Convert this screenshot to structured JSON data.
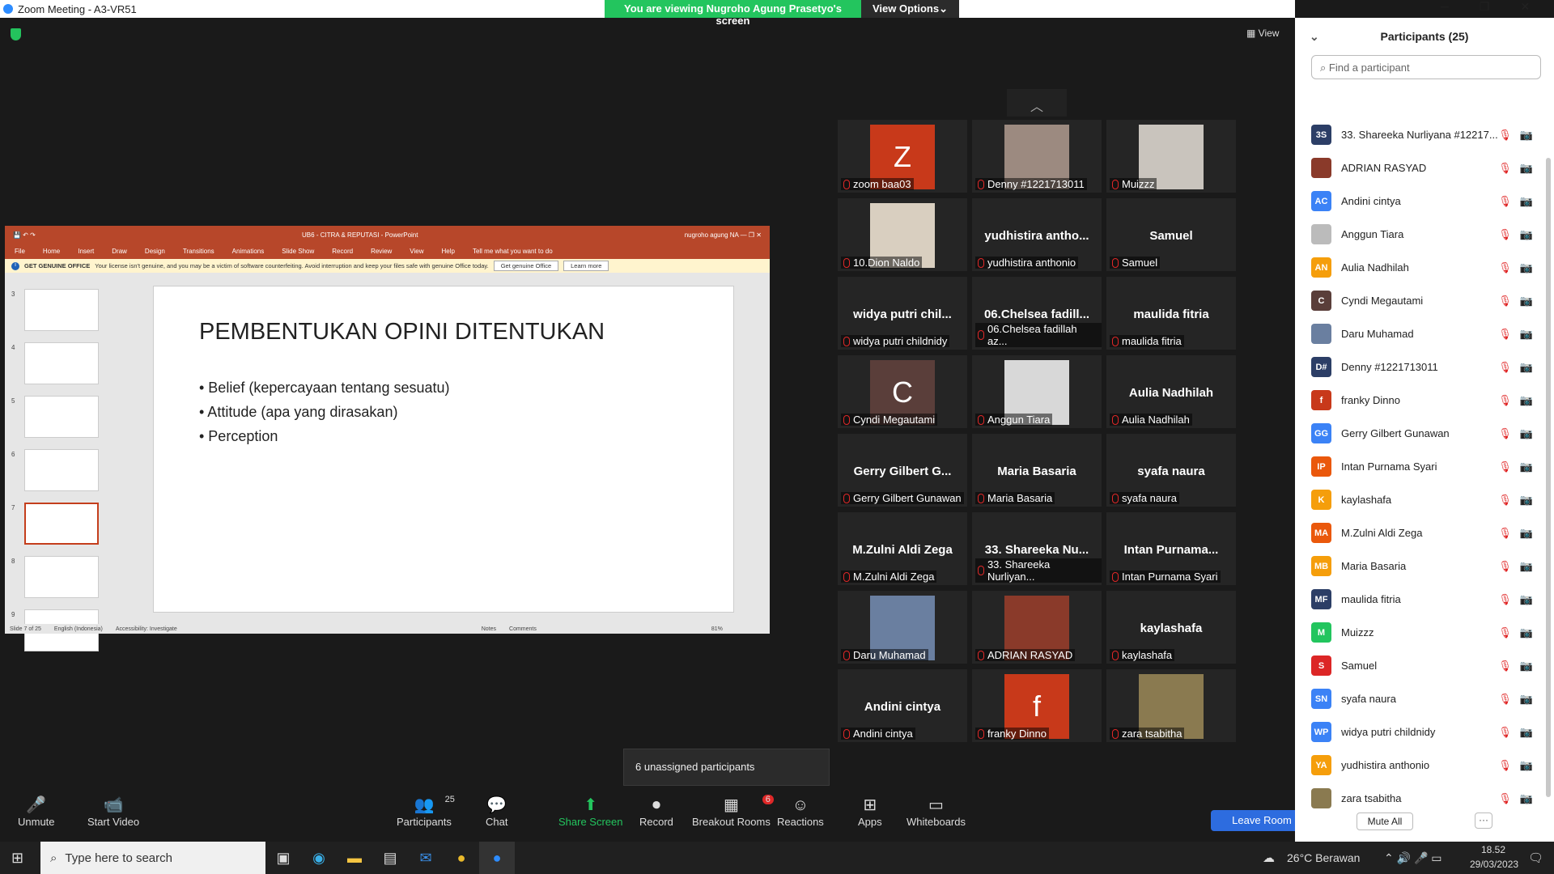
{
  "window": {
    "title": "Zoom Meeting - A3-VR51"
  },
  "banner": {
    "text": "You are viewing Nugroho Agung Prasetyo's screen",
    "view_options": "View Options"
  },
  "view_button": "View",
  "ppt": {
    "title": "UB6 - CITRA & REPUTASI  -  PowerPoint",
    "user": "nugroho agung",
    "user_initials": "NA",
    "tabs": [
      "File",
      "Home",
      "Insert",
      "Draw",
      "Design",
      "Transitions",
      "Animations",
      "Slide Show",
      "Record",
      "Review",
      "View",
      "Help",
      "Tell me what you want to do"
    ],
    "warning_title": "GET GENUINE OFFICE",
    "warning_text": "Your license isn't genuine, and you may be a victim of software counterfeiting. Avoid interruption and keep your files safe with genuine Office today.",
    "warning_btn": "Get genuine Office",
    "warning_more": "Learn more",
    "thumbs": [
      "3",
      "4",
      "5",
      "6",
      "7",
      "8",
      "9"
    ],
    "slide_title": "PEMBENTUKAN OPINI DITENTUKAN",
    "bullets": [
      "• Belief (kepercayaan tentang sesuatu)",
      "• Attitude (apa yang dirasakan)",
      "• Perception"
    ],
    "status": {
      "slide": "Slide 7 of 25",
      "lang": "English (Indonesia)",
      "access": "Accessibility: Investigate",
      "notes": "Notes",
      "comments": "Comments",
      "zoom": "81%"
    }
  },
  "gallery": [
    {
      "label": "zoom baa03",
      "avatar": "Z",
      "color": "#c8391a"
    },
    {
      "label": "Denny #1221713011",
      "avatar": "",
      "color": "#9c8a80"
    },
    {
      "label": "Muizzz",
      "avatar": "",
      "color": "#c9c4bd"
    },
    {
      "label": "10.Dion Naldo",
      "avatar": "",
      "color": "#d9cfc0"
    },
    {
      "label": "yudhistira anthonio",
      "name": "yudhistira antho..."
    },
    {
      "label": "Samuel",
      "name": "Samuel"
    },
    {
      "label": "widya putri childnidy",
      "name": "widya putri chil..."
    },
    {
      "label": "06.Chelsea fadillah az...",
      "name": "06.Chelsea fadill..."
    },
    {
      "label": "maulida fitria",
      "name": "maulida fitria"
    },
    {
      "label": "Cyndi Megautami",
      "avatar": "C",
      "color": "#5a3e3a"
    },
    {
      "label": "Anggun Tiara",
      "avatar": "",
      "color": "#d8d8d8"
    },
    {
      "label": "Aulia Nadhilah",
      "name": "Aulia Nadhilah"
    },
    {
      "label": "Gerry Gilbert Gunawan",
      "name": "Gerry Gilbert G..."
    },
    {
      "label": "Maria Basaria",
      "name": "Maria Basaria"
    },
    {
      "label": "syafa naura",
      "name": "syafa naura"
    },
    {
      "label": "M.Zulni Aldi Zega",
      "name": "M.Zulni Aldi Zega"
    },
    {
      "label": "33. Shareeka Nurliyan...",
      "name": "33. Shareeka Nu..."
    },
    {
      "label": "Intan Purnama Syari",
      "name": "Intan Purnama..."
    },
    {
      "label": "Daru Muhamad",
      "avatar": "",
      "color": "#6a7fa0"
    },
    {
      "label": "ADRIAN RASYAD",
      "avatar": "",
      "color": "#8a3a2a"
    },
    {
      "label": "kaylashafa",
      "name": "kaylashafa"
    },
    {
      "label": "Andini cintya",
      "name": "Andini cintya"
    },
    {
      "label": "franky Dinno",
      "avatar": "f",
      "color": "#c8391a"
    },
    {
      "label": "zara tsabitha",
      "avatar": "",
      "color": "#8a7a50"
    }
  ],
  "unassigned": "6 unassigned participants",
  "toolbar": [
    {
      "label": "Unmute",
      "icon": "🎤"
    },
    {
      "label": "Start Video",
      "icon": "📹"
    },
    {
      "label": "Participants",
      "icon": "👥",
      "count": "25"
    },
    {
      "label": "Chat",
      "icon": "💬"
    },
    {
      "label": "Share Screen",
      "icon": "⬆"
    },
    {
      "label": "Record",
      "icon": "⏺"
    },
    {
      "label": "Breakout Rooms",
      "icon": "▦",
      "count": "6"
    },
    {
      "label": "Reactions",
      "icon": "☺"
    },
    {
      "label": "Apps",
      "icon": "⊞"
    },
    {
      "label": "Whiteboards",
      "icon": "▭"
    }
  ],
  "leave": "Leave Room",
  "panel": {
    "title": "Participants (25)",
    "search_placeholder": "Find a participant",
    "mute_all": "Mute All",
    "more": "···",
    "items": [
      {
        "initials": "3S",
        "name": "33. Shareeka Nurliyana #12217...",
        "color": "#2c3e66"
      },
      {
        "initials": "",
        "name": "ADRIAN RASYAD",
        "color": "#8a3a2a"
      },
      {
        "initials": "AC",
        "name": "Andini cintya",
        "color": "#3b82f6"
      },
      {
        "initials": "",
        "name": "Anggun Tiara",
        "color": "#bbb"
      },
      {
        "initials": "AN",
        "name": "Aulia Nadhilah",
        "color": "#f59e0b"
      },
      {
        "initials": "C",
        "name": "Cyndi Megautami",
        "color": "#5a3e3a"
      },
      {
        "initials": "",
        "name": "Daru Muhamad",
        "color": "#6a7fa0"
      },
      {
        "initials": "D#",
        "name": "Denny #1221713011",
        "color": "#2c3e66"
      },
      {
        "initials": "f",
        "name": "franky Dinno",
        "color": "#c8391a"
      },
      {
        "initials": "GG",
        "name": "Gerry Gilbert Gunawan",
        "color": "#3b82f6"
      },
      {
        "initials": "IP",
        "name": "Intan Purnama Syari",
        "color": "#ea580c"
      },
      {
        "initials": "K",
        "name": "kaylashafa",
        "color": "#f59e0b"
      },
      {
        "initials": "MA",
        "name": "M.Zulni Aldi Zega",
        "color": "#ea580c"
      },
      {
        "initials": "MB",
        "name": "Maria Basaria",
        "color": "#f59e0b"
      },
      {
        "initials": "MF",
        "name": "maulida fitria",
        "color": "#2c3e66"
      },
      {
        "initials": "M",
        "name": "Muizzz",
        "color": "#22c55e"
      },
      {
        "initials": "S",
        "name": "Samuel",
        "color": "#dc2626"
      },
      {
        "initials": "SN",
        "name": "syafa naura",
        "color": "#3b82f6"
      },
      {
        "initials": "WP",
        "name": "widya putri childnidy",
        "color": "#3b82f6"
      },
      {
        "initials": "YA",
        "name": "yudhistira anthonio",
        "color": "#f59e0b"
      },
      {
        "initials": "",
        "name": "zara tsabitha",
        "color": "#8a7a50"
      }
    ]
  },
  "taskbar": {
    "search": "Type here to search",
    "weather": "26°C  Berawan",
    "time": "18.52",
    "date": "29/03/2023"
  }
}
